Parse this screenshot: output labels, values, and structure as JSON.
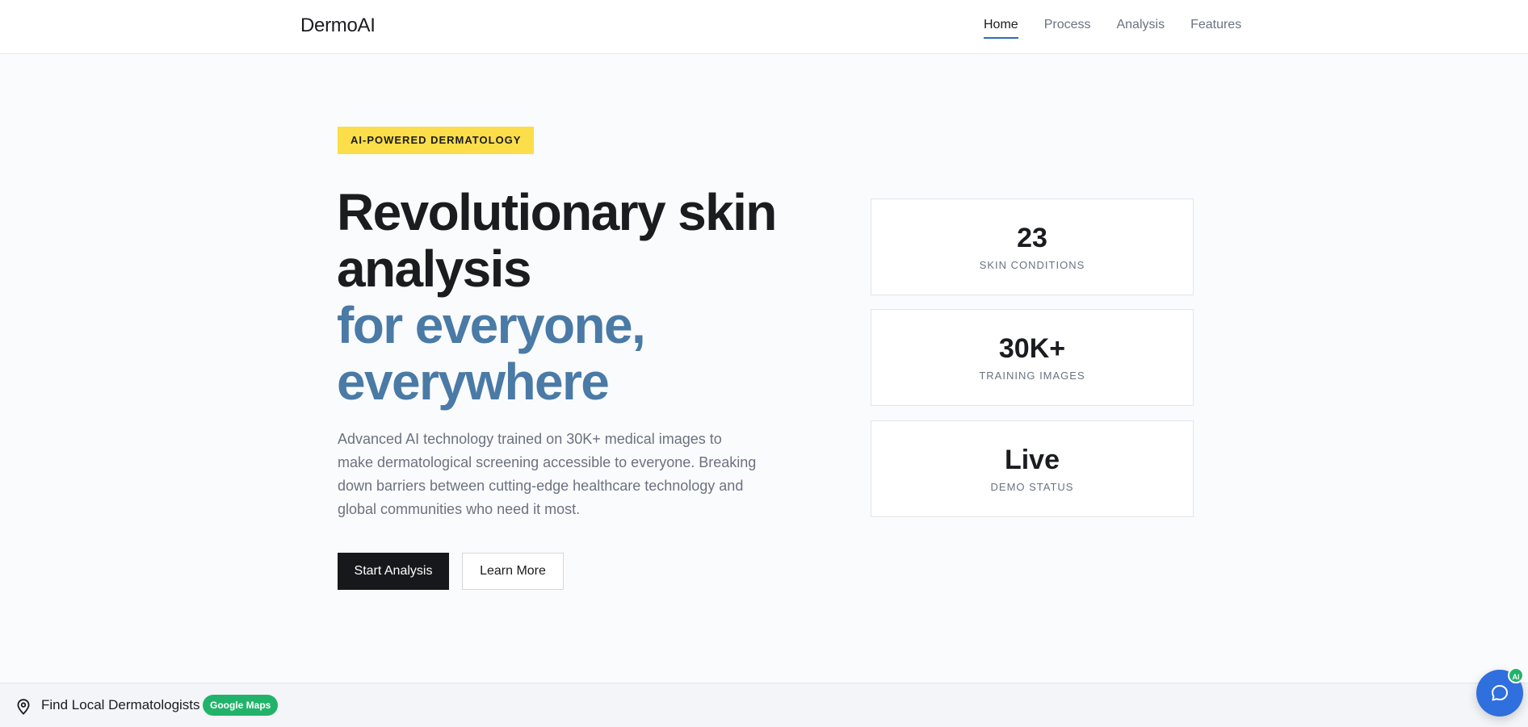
{
  "header": {
    "logo": "DermoAI",
    "nav": [
      {
        "label": "Home",
        "active": true
      },
      {
        "label": "Process",
        "active": false
      },
      {
        "label": "Analysis",
        "active": false
      },
      {
        "label": "Features",
        "active": false
      }
    ]
  },
  "hero": {
    "badge": "AI-POWERED DERMATOLOGY",
    "headline_line1": "Revolutionary skin",
    "headline_line2": "analysis",
    "headline_accent1": "for everyone,",
    "headline_accent2": "everywhere",
    "description": "Advanced AI technology trained on 30K+ medical images to make dermatological screening accessible to everyone. Breaking down barriers between cutting-edge healthcare technology and global communities who need it most.",
    "primary_button": "Start Analysis",
    "secondary_button": "Learn More"
  },
  "stats": [
    {
      "value": "23",
      "label": "SKIN CONDITIONS"
    },
    {
      "value": "30K+",
      "label": "TRAINING IMAGES"
    },
    {
      "value": "Live",
      "label": "DEMO STATUS"
    }
  ],
  "bottom_bar": {
    "label": "Find Local Dermatologists",
    "badge": "Google Maps",
    "icon": "map-pin-icon"
  },
  "chat": {
    "icon": "chat-bubble-icon",
    "badge": "AI"
  },
  "colors": {
    "accent_blue": "#4a7aa6",
    "badge_yellow": "#fbde4a",
    "primary_dark": "#17181b",
    "maps_green": "#22b36b",
    "chat_blue": "#2f6fde"
  }
}
